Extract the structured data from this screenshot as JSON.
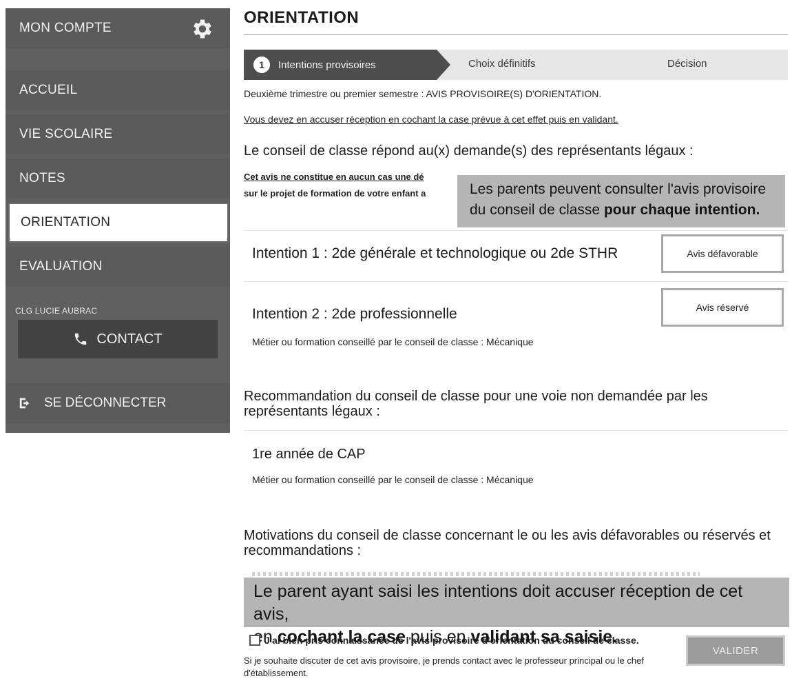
{
  "sidebar": {
    "account_label": "MON COMPTE",
    "items": [
      {
        "label": "ACCUEIL"
      },
      {
        "label": "VIE SCOLAIRE"
      },
      {
        "label": "NOTES"
      },
      {
        "label": "ORIENTATION"
      },
      {
        "label": "EVALUATION"
      }
    ],
    "school_name": "CLG LUCIE AUBRAC",
    "contact_label": "CONTACT",
    "logout_label": "SE DÉCONNECTER"
  },
  "main": {
    "title": "ORIENTATION",
    "steps": [
      {
        "number": "1",
        "label": "Intentions provisoires"
      },
      {
        "label": "Choix définitifs"
      },
      {
        "label": "Décision"
      }
    ],
    "intro_line": "Deuxième trimestre ou premier semestre : AVIS PROVISOIRE(S) D'ORIENTATION.",
    "instruction_line": "Vous devez en accuser réception en cochant la case prévue à cet effet puis en validant.",
    "section_heading": "Le conseil de classe répond au(x) demande(s) des représentants légaux :",
    "warning_line1": "Cet avis ne constitue en aucun cas une dé",
    "warning_line2": "sur le projet de formation de votre enfant a",
    "callout1_line1": "Les parents peuvent consulter l'avis provisoire",
    "callout1_line2_normal": "du conseil de classe ",
    "callout1_line2_bold": "pour chaque intention.",
    "intentions": [
      {
        "prefix": "Intention 1",
        "text": " : 2de générale et technologique ou 2de STHR",
        "avis": "Avis défavorable"
      },
      {
        "prefix": "Intention 2",
        "text": " : 2de professionnelle",
        "avis": "Avis réservé",
        "advice": "Métier ou formation conseillé par le conseil de classe : Mécanique"
      }
    ],
    "recommendation_heading": "Recommandation du conseil de classe pour une voie non demandée par les représentants légaux :",
    "recommendation": {
      "title": "1re année de CAP",
      "advice": "Métier ou formation conseillé par le conseil de classe : Mécanique"
    },
    "motivations_heading": "Motivations du conseil de classe concernant le ou les avis défavorables ou réservés et recommandations :",
    "callout2_line1": "Le parent ayant saisi les intentions doit accuser réception de cet avis,",
    "callout2_line2_a": "en ",
    "callout2_line2_b": "cochant la case",
    "callout2_line2_c": " puis en ",
    "callout2_line2_d": "validant sa saisie.",
    "checkbox_label": "J'ai bien pris connaissance de l'avis provisoire d'orientation du conseil de classe.",
    "contact_note": "Si je souhaite discuter de cet avis provisoire, je prends contact avec le professeur principal ou le chef d'établissement.",
    "validate_label": "VALIDER"
  }
}
